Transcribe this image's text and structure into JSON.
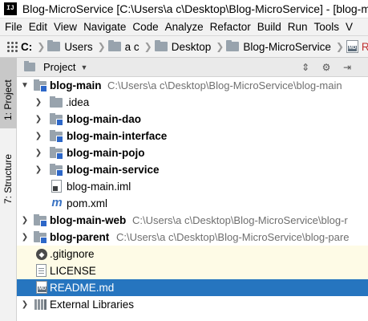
{
  "window": {
    "title": "Blog-MicroService [C:\\Users\\a   c\\Desktop\\Blog-MicroService] - [blog-m"
  },
  "menu": [
    {
      "label": "File"
    },
    {
      "label": "Edit"
    },
    {
      "label": "View"
    },
    {
      "label": "Navigate"
    },
    {
      "label": "Code"
    },
    {
      "label": "Analyze"
    },
    {
      "label": "Refactor"
    },
    {
      "label": "Build"
    },
    {
      "label": "Run"
    },
    {
      "label": "Tools"
    },
    {
      "label": "V"
    }
  ],
  "breadcrumb": {
    "drive": "C:",
    "users": "Users",
    "user_name": "a   c",
    "desktop": "Desktop",
    "project": "Blog-MicroService",
    "file": "READM"
  },
  "tool_strip": {
    "project_tab": "1: Project",
    "structure_tab": "7: Structure"
  },
  "project_panel": {
    "title": "Project"
  },
  "tree": [
    {
      "name": "blog-main",
      "path": "C:\\Users\\a   c\\Desktop\\Blog-MicroService\\blog-main"
    },
    {
      "name": ".idea"
    },
    {
      "name": "blog-main-dao"
    },
    {
      "name": "blog-main-interface"
    },
    {
      "name": "blog-main-pojo"
    },
    {
      "name": "blog-main-service"
    },
    {
      "name": "blog-main.iml"
    },
    {
      "name": "pom.xml"
    },
    {
      "name": "blog-main-web",
      "path": "C:\\Users\\a   c\\Desktop\\Blog-MicroService\\blog-r"
    },
    {
      "name": "blog-parent",
      "path": "C:\\Users\\a   c\\Desktop\\Blog-MicroService\\blog-pare"
    },
    {
      "name": ".gitignore"
    },
    {
      "name": "LICENSE"
    },
    {
      "name": "README.md"
    },
    {
      "name": "External Libraries"
    }
  ]
}
